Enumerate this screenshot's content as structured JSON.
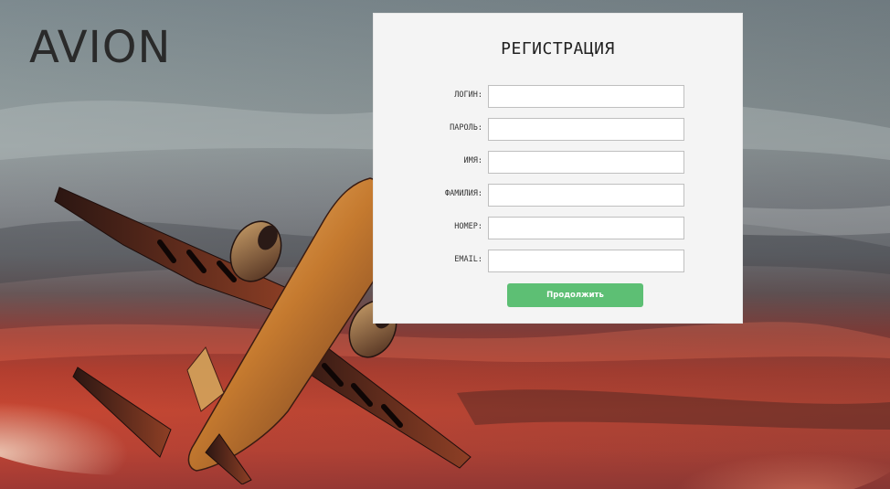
{
  "brand": {
    "logo_text": "AVION"
  },
  "form": {
    "title": "РЕГИСТРАЦИЯ",
    "fields": [
      {
        "label": "ЛОГИН:",
        "value": "",
        "placeholder": ""
      },
      {
        "label": "ПАРОЛЬ:",
        "value": "",
        "placeholder": ""
      },
      {
        "label": "ИМЯ:",
        "value": "",
        "placeholder": ""
      },
      {
        "label": "ФАМИЛИЯ:",
        "value": "",
        "placeholder": ""
      },
      {
        "label": "НОМЕР:",
        "value": "",
        "placeholder": ""
      },
      {
        "label": "EMAIL:",
        "value": "",
        "placeholder": ""
      }
    ],
    "submit_label": "Продолжить"
  },
  "colors": {
    "button": "#5dbf74",
    "card_background": "#f4f4f4",
    "logo": "#2a2a2a"
  },
  "icons": {
    "hero_image": "airplane-at-sunset"
  }
}
